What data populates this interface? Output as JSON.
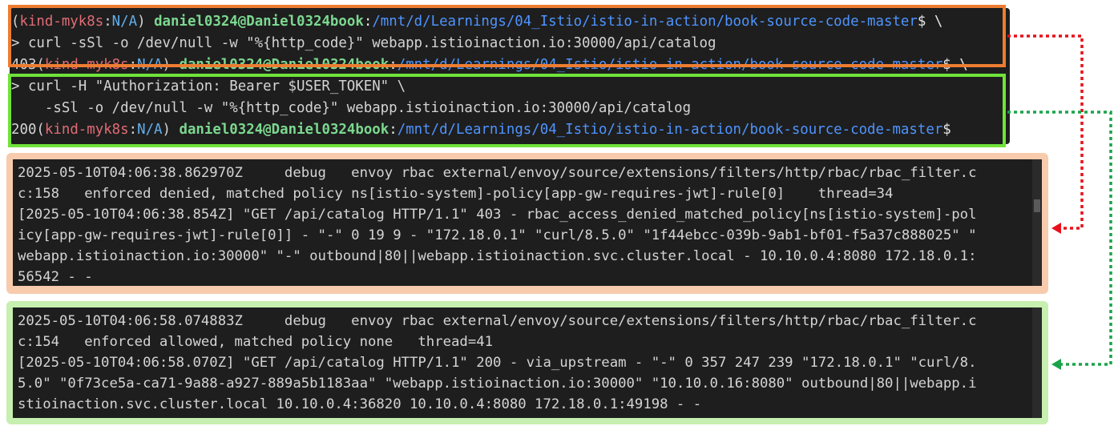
{
  "terminal": {
    "line1": {
      "env_open": "(",
      "env_name": "kind-myk8s",
      "env_sep": ":",
      "env_ns": "N/A",
      "env_close": ")",
      "user_host": "daniel0324@Daniel0324book",
      "colon": ":",
      "path": "/mnt/d/Learnings/04_Istio/istio-in-action/book-source-code-master",
      "tail": "$ \\"
    },
    "line2": "> curl -sSl -o /dev/null -w \"%{http_code}\" webapp.istioinaction.io:30000/api/catalog",
    "line3": {
      "code": "403",
      "env_open": "(",
      "env_name": "kind-myk8s",
      "env_sep": ":",
      "env_ns": "N/A",
      "env_close": ")",
      "user_host": "daniel0324@Daniel0324book",
      "colon": ":",
      "path": "/mnt/d/Learnings/04_Istio/istio-in-action/book-source-code-master",
      "tail": "$ \\"
    },
    "line4": "> curl -H \"Authorization: Bearer $USER_TOKEN\" \\",
    "line5": "    -sSl -o /dev/null -w \"%{http_code}\" webapp.istioinaction.io:30000/api/catalog",
    "line6": {
      "code": "200",
      "env_open": "(",
      "env_name": "kind-myk8s",
      "env_sep": ":",
      "env_ns": "N/A",
      "env_close": ")",
      "user_host": "daniel0324@Daniel0324book",
      "colon": ":",
      "path": "/mnt/d/Learnings/04_Istio/istio-in-action/book-source-code-master",
      "tail": "$ "
    }
  },
  "log_denied": [
    "2025-05-10T04:06:38.862970Z     debug   envoy rbac external/envoy/source/extensions/filters/http/rbac/rbac_filter.c",
    "c:158   enforced denied, matched policy ns[istio-system]-policy[app-gw-requires-jwt]-rule[0]    thread=34",
    "[2025-05-10T04:06:38.854Z] \"GET /api/catalog HTTP/1.1\" 403 - rbac_access_denied_matched_policy[ns[istio-system]-pol",
    "icy[app-gw-requires-jwt]-rule[0]] - \"-\" 0 19 9 - \"172.18.0.1\" \"curl/8.5.0\" \"1f44ebcc-039b-9ab1-bf01-f5a37c888025\" \"",
    "webapp.istioinaction.io:30000\" \"-\" outbound|80||webapp.istioinaction.svc.cluster.local - 10.10.0.4:8080 172.18.0.1:",
    "56542 - -"
  ],
  "log_allowed": [
    "2025-05-10T04:06:58.074883Z     debug   envoy rbac external/envoy/source/extensions/filters/http/rbac/rbac_filter.c",
    "c:154   enforced allowed, matched policy none   thread=41",
    "[2025-05-10T04:06:58.070Z] \"GET /api/catalog HTTP/1.1\" 200 - via_upstream - \"-\" 0 357 247 239 \"172.18.0.1\" \"curl/8.",
    "5.0\" \"0f73ce5a-ca71-9a88-a927-889a5b1183aa\" \"webapp.istioinaction.io:30000\" \"10.10.0.16:8080\" outbound|80||webapp.i",
    "stioinaction.svc.cluster.local 10.10.0.4:36820 10.10.0.4:8080 172.18.0.1:49198 - -"
  ],
  "colors": {
    "terminal_bg": "#1e1e1e",
    "orange_highlight": "#ed7d31",
    "lime_highlight": "#70e33a",
    "red_arrow": "#e8101a",
    "green_arrow": "#1aa34a",
    "orange_panel": "#f8cbad",
    "green_panel": "#c6efb0"
  }
}
